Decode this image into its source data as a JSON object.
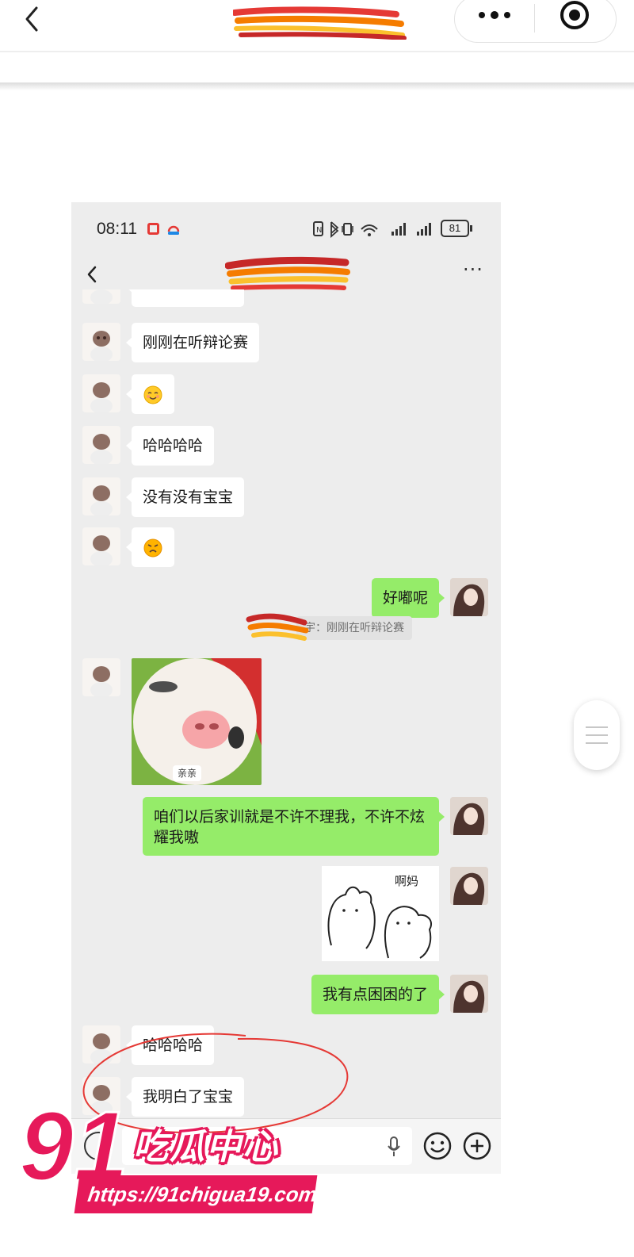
{
  "outer": {
    "title": "",
    "back_icon": "chevron-left-icon",
    "more_icon": "more-dots-icon",
    "close_icon": "target-circle-icon"
  },
  "status_bar": {
    "time": "08:11",
    "battery": "81"
  },
  "chat": {
    "title": "",
    "messages": [
      {
        "side": "left",
        "text": "刚刚在听辩论赛"
      },
      {
        "side": "left",
        "emoji": "smiling-face-icon"
      },
      {
        "side": "left",
        "text": "哈哈哈哈"
      },
      {
        "side": "left",
        "text": "没有没有宝宝"
      },
      {
        "side": "left",
        "emoji": "angry-face-icon"
      },
      {
        "side": "right",
        "text": "好嘟呢"
      },
      {
        "side": "right",
        "quote": "宇：刚刚在听辩论赛"
      },
      {
        "side": "left",
        "sticker": "cat-kiss-sticker",
        "caption": "亲亲"
      },
      {
        "side": "right",
        "text": "咱们以后家训就是不许不理我，不许不炫耀我嗷"
      },
      {
        "side": "right",
        "sticker": "doodle-hug-sticker",
        "caption": "啊妈"
      },
      {
        "side": "right",
        "text": "我有点困困的了"
      },
      {
        "side": "left",
        "text": "哈哈哈哈"
      },
      {
        "side": "left",
        "text": "我明白了宝宝"
      }
    ]
  },
  "input_bar": {
    "value": "",
    "voice_icon": "voice-icon",
    "mic_icon": "mic-icon",
    "emoji_icon": "emoji-icon",
    "plus_icon": "plus-icon"
  },
  "watermark": {
    "number": "91",
    "name": "吃瓜中心",
    "url": "https://91chigua19.com"
  },
  "colors": {
    "my_bubble": "#95ec69",
    "their_bubble": "#ffffff",
    "chat_bg": "#ededed",
    "watermark": "#e6195a"
  }
}
